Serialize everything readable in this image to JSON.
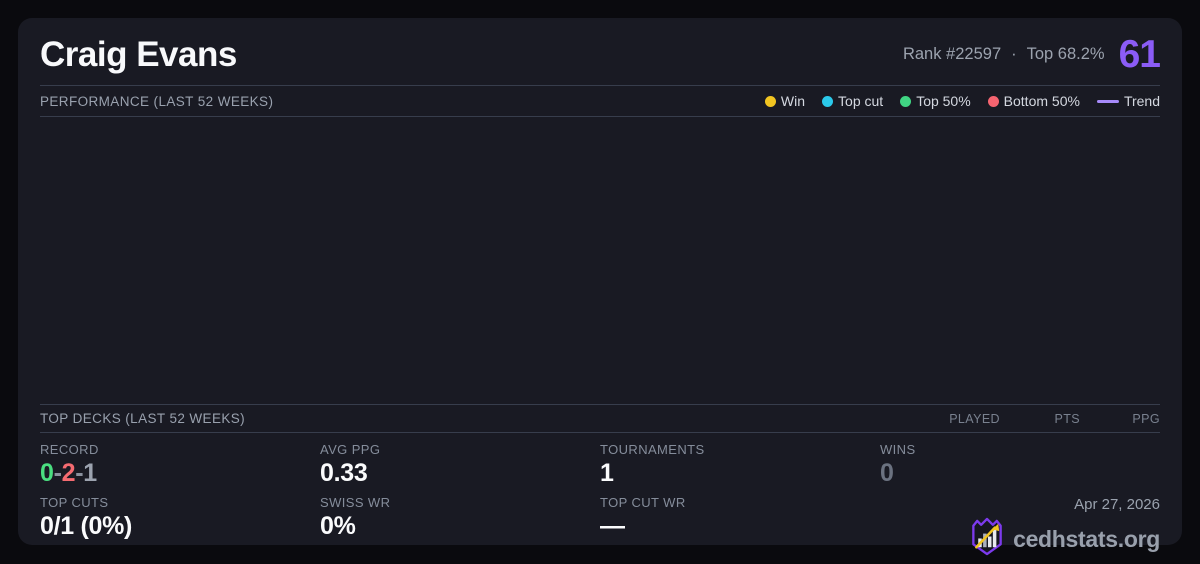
{
  "player": {
    "name": "Craig Evans",
    "rank": "Rank #22597",
    "separator": "·",
    "top_percent": "Top 68.2%",
    "score": "61"
  },
  "performance": {
    "title": "PERFORMANCE (LAST 52 WEEKS)",
    "legend": [
      {
        "label": "Win",
        "color": "#f2c521"
      },
      {
        "label": "Top cut",
        "color": "#2bc9ea"
      },
      {
        "label": "Top 50%",
        "color": "#40d583"
      },
      {
        "label": "Bottom 50%",
        "color": "#f56470"
      },
      {
        "label": "Trend",
        "color": "#a78bfa"
      }
    ],
    "chart_data": {
      "type": "scatter",
      "points": []
    }
  },
  "top_decks": {
    "title": "TOP DECKS (LAST 52 WEEKS)",
    "columns": [
      "PLAYED",
      "PTS",
      "PPG"
    ],
    "rows": []
  },
  "stats": {
    "record": {
      "label": "RECORD",
      "wins": "0",
      "separator": "-",
      "losses": "2",
      "draws": "1"
    },
    "avg_ppg": {
      "label": "AVG PPG",
      "value": "0.33"
    },
    "tournaments": {
      "label": "TOURNAMENTS",
      "value": "1"
    },
    "wins": {
      "label": "WINS",
      "value": "0"
    },
    "top_cuts": {
      "label": "TOP CUTS",
      "value": "0/1 (0%)"
    },
    "swiss_wr": {
      "label": "SWISS WR",
      "value": "0%"
    },
    "top_cut_wr": {
      "label": "TOP CUT WR",
      "value": "—"
    }
  },
  "footer": {
    "date": "Apr 27, 2026",
    "site": "cedhstats.org"
  },
  "colors": {
    "accent": "#8b5cf6",
    "win": "#f2c521",
    "top_cut": "#2bc9ea",
    "top_50": "#40d583",
    "bottom_50": "#f56470",
    "trend": "#a78bfa",
    "record_win": "#4ade80",
    "record_loss": "#f56b71",
    "record_draw": "#9ca3af"
  }
}
